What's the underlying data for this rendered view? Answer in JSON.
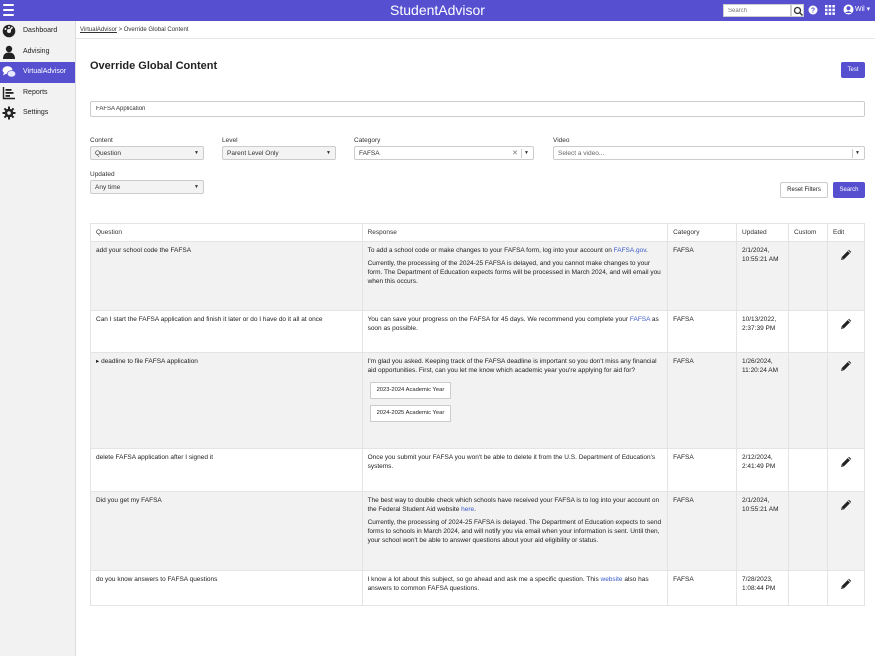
{
  "app": {
    "title": "StudentAdvisor",
    "search_placeholder": "Search",
    "user": "Wil ▾"
  },
  "sidebar": {
    "items": [
      {
        "label": "Dashboard",
        "icon": "dashboard-icon"
      },
      {
        "label": "Advising",
        "icon": "person-icon"
      },
      {
        "label": "VirtualAdvisor",
        "icon": "chat-icon"
      },
      {
        "label": "Reports",
        "icon": "bar-chart-icon"
      },
      {
        "label": "Settings",
        "icon": "gear-icon"
      }
    ]
  },
  "breadcrumb": {
    "root": "VirtualAdvisor",
    "sep": " > ",
    "current": "Override Global Content"
  },
  "page": {
    "title": "Override Global Content",
    "test_label": "Test",
    "input_value": "FAFSA Application"
  },
  "filters": {
    "content_label": "Content",
    "content_value": "Question",
    "level_label": "Level",
    "level_value": "Parent Level Only",
    "category_label": "Category",
    "category_value": "FAFSA",
    "video_label": "Video",
    "video_placeholder": "Select a video...",
    "updated_label": "Updated",
    "updated_value": "Any time",
    "reset_label": "Reset Filters",
    "search_label": "Search"
  },
  "table": {
    "headers": {
      "question": "Question",
      "response": "Response",
      "category": "Category",
      "updated": "Updated",
      "custom": "Custom",
      "edit": "Edit"
    },
    "rows": [
      {
        "question": "add your school code the FAFSA",
        "r1a": "To add a school code or make changes to your FAFSA form, log into your account on ",
        "r1link": "FAFSA.gov",
        "r1b": ".",
        "r2": "Currently, the processing of the 2024-25 FAFSA is delayed, and you cannot make changes to your form. The Department of Education expects forms will be processed in March 2024, and will email you when this occurs.",
        "category": "FAFSA",
        "updated": "2/1/2024, 10:55:21 AM"
      },
      {
        "question": "Can I start the FAFSA application and finish it later or do I have do it all at once",
        "r1a": "You can save your progress on the FAFSA for 45 days. We recommend you complete your ",
        "r1link": "FAFSA",
        "r1b": " as soon as possible.",
        "category": "FAFSA",
        "updated": "10/13/2022, 2:37:39 PM"
      },
      {
        "question": "deadline to file FAFSA application",
        "expander": "▸",
        "r1a": "I'm glad you asked. Keeping track of the FAFSA deadline is important so you don't miss any financial aid opportunities. First, can you let me know which academic year you're applying for aid for?",
        "chip1": "2023-2024 Academic Year",
        "chip2": "2024-2025 Academic Year",
        "category": "FAFSA",
        "updated": "1/26/2024, 11:20:24 AM"
      },
      {
        "question": "delete FAFSA application after I signed it",
        "r1a": "Once you submit your FAFSA you won't be able to delete it from the U.S. Department of Education's systems.",
        "category": "FAFSA",
        "updated": "2/12/2024, 2:41:49 PM"
      },
      {
        "question": "Did you get my FAFSA",
        "r1a": "The best way to double check which schools have received your FAFSA is to log into your account on the Federal Student Aid website ",
        "r1link": "here",
        "r1b": ".",
        "r2": "Currently, the processing of 2024-25 FAFSA is delayed. The Department of Education expects to send forms to schools in March 2024, and will notify you via email when your information is sent. Until then, your school won't be able to answer questions about your aid eligibility or status.",
        "category": "FAFSA",
        "updated": "2/1/2024, 10:55:21 AM"
      },
      {
        "question": "do you know answers to FAFSA questions",
        "r1a": "I know a lot about this subject, so go ahead and ask me a specific question. This ",
        "r1link": "website",
        "r1b": " also has answers to common FAFSA questions.",
        "category": "FAFSA",
        "updated": "7/28/2023, 1:08:44 PM"
      }
    ]
  },
  "colors": {
    "brand": "#5650d0",
    "link": "#3b5bc8"
  }
}
